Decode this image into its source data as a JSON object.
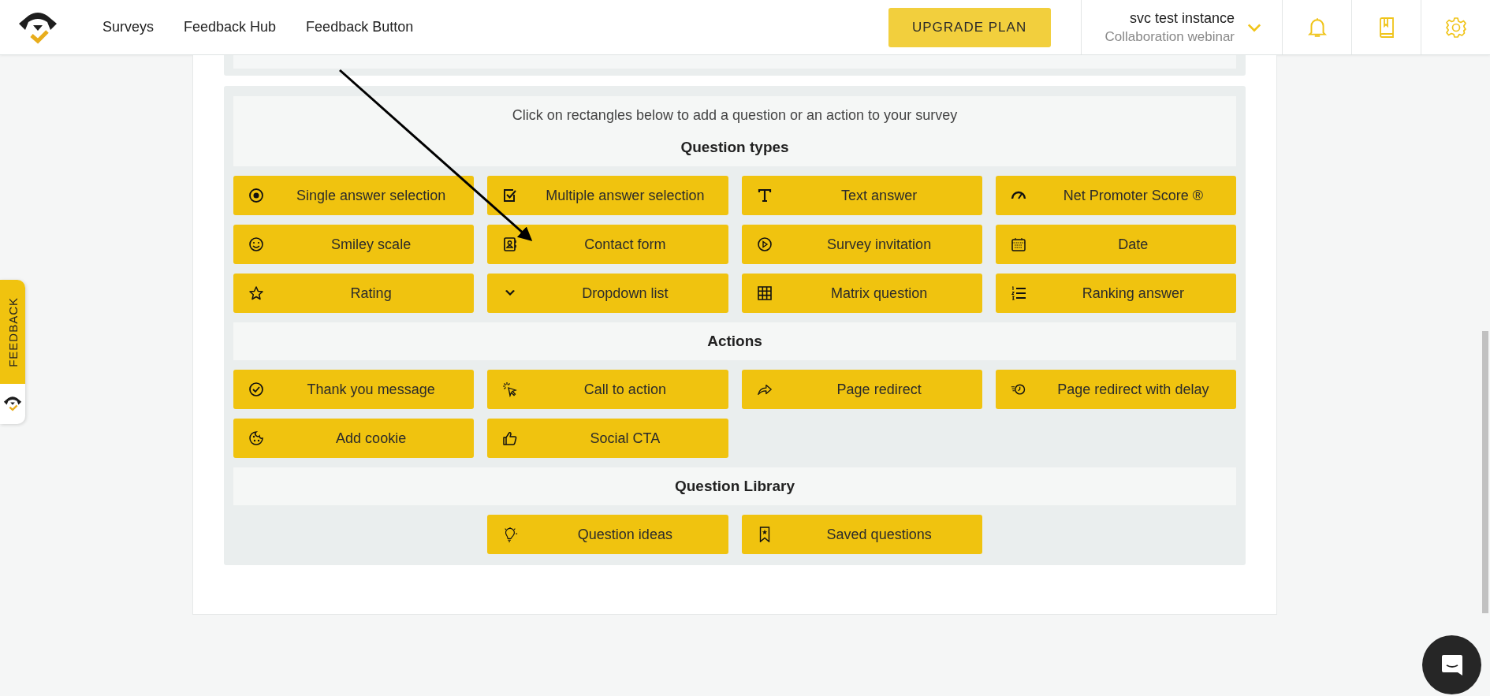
{
  "nav": [
    "Surveys",
    "Feedback Hub",
    "Feedback Button"
  ],
  "upgrade": "UPGRADE PLAN",
  "account": {
    "name": "svc test instance",
    "subtitle": "Collaboration webinar"
  },
  "intro": "Click on rectangles below to add a question or an action to your survey",
  "sections": [
    {
      "title": "Question types",
      "items": [
        {
          "label": "Single answer selection",
          "kind": "radio"
        },
        {
          "label": "Multiple answer selection",
          "kind": "checkbox"
        },
        {
          "label": "Text answer",
          "kind": "text"
        },
        {
          "label": "Net Promoter Score ®",
          "kind": "gauge"
        },
        {
          "label": "Smiley scale",
          "kind": "smiley"
        },
        {
          "label": "Contact form",
          "kind": "contact"
        },
        {
          "label": "Survey invitation",
          "kind": "play"
        },
        {
          "label": "Date",
          "kind": "calendar"
        },
        {
          "label": "Rating",
          "kind": "star"
        },
        {
          "label": "Dropdown list",
          "kind": "chevron"
        },
        {
          "label": "Matrix question",
          "kind": "grid"
        },
        {
          "label": "Ranking answer",
          "kind": "list"
        }
      ]
    },
    {
      "title": "Actions",
      "items": [
        {
          "label": "Thank you message",
          "kind": "check"
        },
        {
          "label": "Call to action",
          "kind": "cursor"
        },
        {
          "label": "Page redirect",
          "kind": "share"
        },
        {
          "label": "Page redirect with delay",
          "kind": "clock"
        },
        {
          "label": "Add cookie",
          "kind": "cookie"
        },
        {
          "label": "Social CTA",
          "kind": "thumb"
        }
      ]
    },
    {
      "title": "Question Library",
      "items": [
        {
          "label": "Question ideas",
          "kind": "bulb"
        },
        {
          "label": "Saved questions",
          "kind": "bookmark"
        }
      ]
    }
  ],
  "feedback_tab": "FEEDBACK"
}
